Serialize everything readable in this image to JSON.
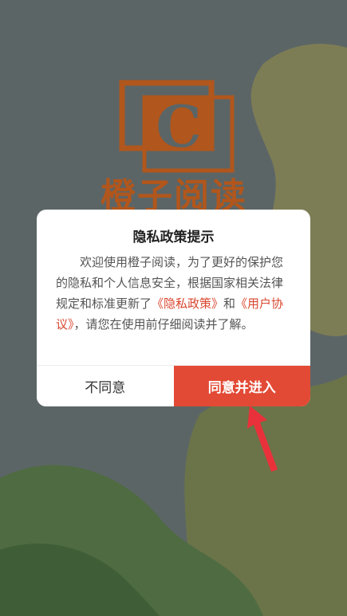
{
  "app": {
    "name": "橙子阅读",
    "logo_letter": "C"
  },
  "dialog": {
    "title": "隐私政策提示",
    "body_intro": "欢迎使用橙子阅读，为了更好的保护您的隐私和个人信息安全，根据国家相关法律规定和标准更新了",
    "privacy_link": "《隐私政策》",
    "conjunction": "和",
    "agreement_link": "《用户协议》",
    "body_outro": "，请您在使用前仔细阅读并了解。",
    "disagree_label": "不同意",
    "agree_label": "同意并进入"
  },
  "colors": {
    "accent": "#e24a35",
    "link": "#d9472f",
    "logo": "#b1561c"
  },
  "icons": {
    "pointer": "red-arrow-icon"
  }
}
